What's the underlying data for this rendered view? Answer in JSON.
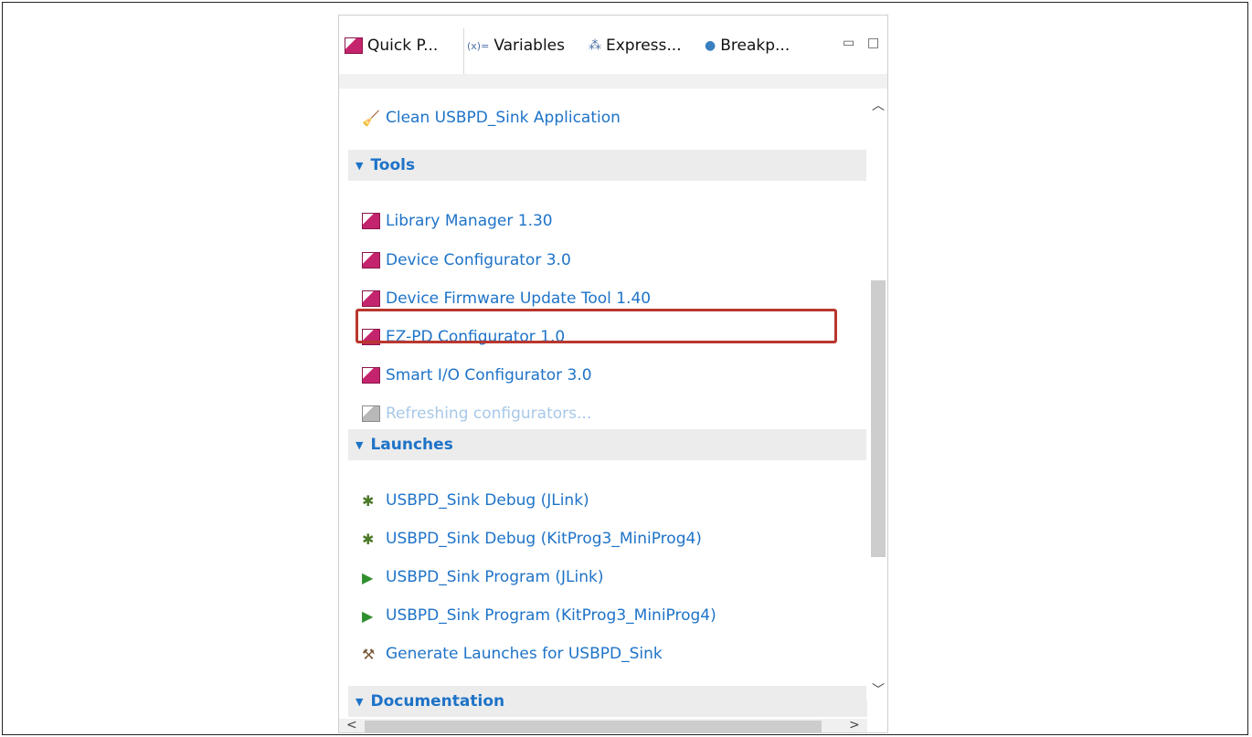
{
  "tabs": [
    {
      "label": "Quick P...",
      "icon": "quick-panel-icon"
    },
    {
      "label": "Variables",
      "icon": "variables-icon",
      "prefix": "(x)="
    },
    {
      "label": "Express...",
      "icon": "expressions-icon"
    },
    {
      "label": "Breakp...",
      "icon": "breakpoints-icon"
    }
  ],
  "window_controls": {
    "minimize": "▭",
    "maximize": "□"
  },
  "items_top": [
    {
      "label": "Clean USBPD_Sink Application",
      "icon": "broom-icon"
    }
  ],
  "sections": {
    "tools": {
      "label": "Tools"
    },
    "launches": {
      "label": "Launches"
    },
    "documentation": {
      "label": "Documentation"
    }
  },
  "tools": [
    {
      "label": "Library Manager 1.30",
      "icon": "configurator-icon"
    },
    {
      "label": "Device Configurator 3.0",
      "icon": "configurator-icon"
    },
    {
      "label": "Device Firmware Update Tool 1.40",
      "icon": "configurator-icon"
    },
    {
      "label": "EZ-PD Configurator 1.0",
      "icon": "ezpd-icon",
      "highlighted": true
    },
    {
      "label": "Smart I/O Configurator 3.0",
      "icon": "configurator-icon"
    },
    {
      "label": "Refreshing configurators...",
      "icon": "configurator-gray-icon",
      "disabled": true
    }
  ],
  "launches": [
    {
      "label": "USBPD_Sink Debug (JLink)",
      "icon": "debug-bug-icon"
    },
    {
      "label": "USBPD_Sink Debug (KitProg3_MiniProg4)",
      "icon": "debug-bug-icon"
    },
    {
      "label": "USBPD_Sink Program (JLink)",
      "icon": "program-play-icon"
    },
    {
      "label": "USBPD_Sink Program (KitProg3_MiniProg4)",
      "icon": "program-play-icon"
    },
    {
      "label": "Generate Launches for USBPD_Sink",
      "icon": "hammer-icon"
    }
  ],
  "colors": {
    "link": "#1e73c8",
    "highlight_border": "#b9372e",
    "section_bg": "#ececec"
  }
}
